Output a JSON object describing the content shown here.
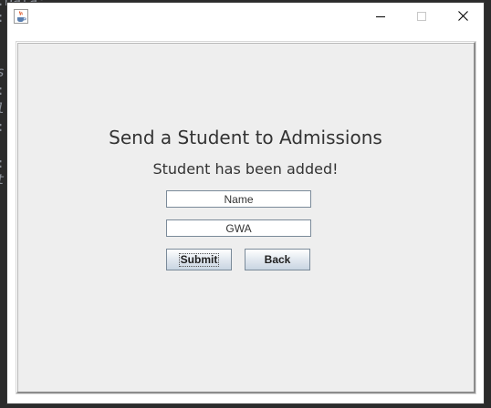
{
  "background_code": {
    "lines": [
      {
        "text": ".Data;"
      },
      {
        "text": ":"
      },
      {
        "text": "s"
      },
      {
        "text": ":"
      },
      {
        "text": "l"
      },
      {
        "text": ":"
      },
      {
        "text": ":"
      },
      {
        "text": "t"
      }
    ]
  },
  "window": {
    "app_icon": "java-coffee-cup-icon",
    "controls": {
      "minimize_icon": "minimize-icon",
      "maximize_icon": "maximize-icon",
      "close_icon": "close-icon"
    }
  },
  "form": {
    "title": "Send a Student to Admissions",
    "status": "Student has been added!",
    "name_field": {
      "value": "Name"
    },
    "gwa_field": {
      "value": "GWA"
    },
    "submit_label": "Submit",
    "back_label": "Back"
  },
  "colors": {
    "panel_bg": "#eeeeee",
    "button_gradient_top": "#ffffff",
    "button_gradient_bottom": "#c9d5e2",
    "border": "#7a8a99",
    "text": "#333333"
  }
}
